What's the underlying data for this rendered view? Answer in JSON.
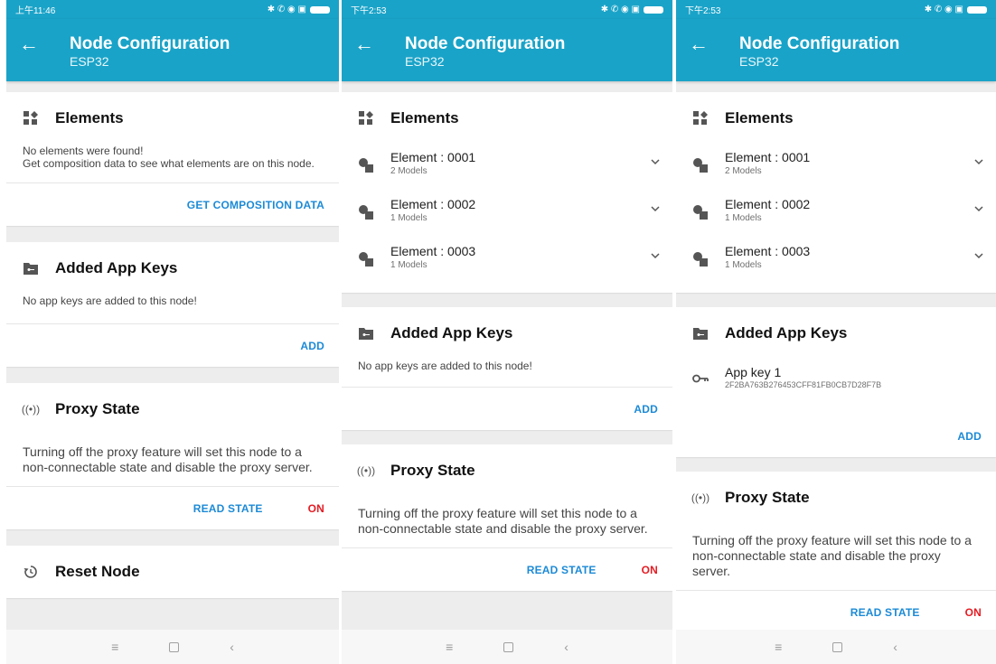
{
  "screens": [
    {
      "time": "上午11:46",
      "status_icons": "✱ ✆ ◉ ▣",
      "title": "Node Configuration",
      "subtitle": "ESP32",
      "elements": {
        "title": "Elements",
        "empty_text": "No elements were found!\nGet composition data to see what elements are on this node.",
        "action": "GET COMPOSITION DATA"
      },
      "app_keys": {
        "title": "Added App Keys",
        "empty_text": "No app keys are added to this node!",
        "add": "ADD"
      },
      "proxy": {
        "title": "Proxy State",
        "desc": "Turning off the proxy feature will set this node to a non-connectable state and disable the proxy server.",
        "read": "READ STATE",
        "on": "ON"
      },
      "reset": {
        "title": "Reset Node"
      }
    },
    {
      "time": "下午2:53",
      "status_icons": "✱ ✆ ◉ ▣",
      "title": "Node Configuration",
      "subtitle": "ESP32",
      "elements": {
        "title": "Elements",
        "items": [
          {
            "name": "Element : 0001",
            "models": "2 Models"
          },
          {
            "name": "Element : 0002",
            "models": "1 Models"
          },
          {
            "name": "Element : 0003",
            "models": "1 Models"
          }
        ]
      },
      "app_keys": {
        "title": "Added App Keys",
        "empty_text": "No app keys are added to this node!",
        "add": "ADD"
      },
      "proxy": {
        "title": "Proxy State",
        "desc": "Turning off the proxy feature will set this node to a non-connectable state and disable the proxy server.",
        "read": "READ STATE",
        "on": "ON"
      }
    },
    {
      "time": "下午2:53",
      "status_icons": "✱ ✆ ◉ ▣",
      "title": "Node Configuration",
      "subtitle": "ESP32",
      "elements": {
        "title": "Elements",
        "items": [
          {
            "name": "Element : 0001",
            "models": "2 Models"
          },
          {
            "name": "Element : 0002",
            "models": "1 Models"
          },
          {
            "name": "Element : 0003",
            "models": "1 Models"
          }
        ]
      },
      "app_keys": {
        "title": "Added App Keys",
        "keys": [
          {
            "name": "App key 1",
            "value": "2F2BA763B276453CFF81FB0CB7D28F7B"
          }
        ],
        "add": "ADD"
      },
      "proxy": {
        "title": "Proxy State",
        "desc": "Turning off the proxy feature will set this node to a non-connectable state and disable the proxy server.",
        "read": "READ STATE",
        "on": "ON"
      }
    }
  ],
  "navbar": {
    "menu_glyph": "≡",
    "back_glyph": "‹"
  },
  "colors": {
    "appbar": "#1aa3c8",
    "action": "#1c8ad6",
    "on": "#e51c23"
  }
}
